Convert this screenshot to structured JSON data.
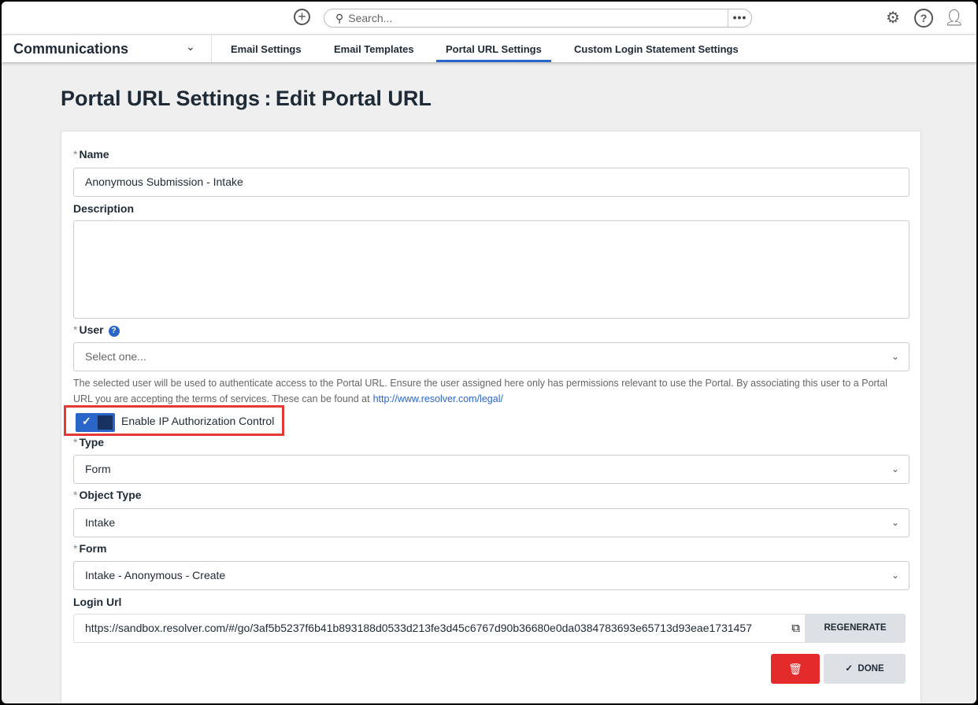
{
  "topbar": {
    "search_placeholder": "Search...",
    "more": "•••",
    "icons": [
      "add-icon",
      "search-icon",
      "settings-icon",
      "help-icon",
      "user-icon"
    ]
  },
  "nav": {
    "app": "Communications",
    "tabs": [
      {
        "label": "Email Settings"
      },
      {
        "label": "Email Templates"
      },
      {
        "label": "Portal URL Settings",
        "active": true
      },
      {
        "label": "Custom Login Statement Settings"
      }
    ]
  },
  "page": {
    "title": "Portal URL Settings : Edit Portal URL"
  },
  "form": {
    "required_mark": "*",
    "name_label": "Name",
    "name_value": "Anonymous Submission - Intake",
    "description_label": "Description",
    "description_value": "",
    "user_label": "User",
    "user_placeholder": "Select one...",
    "help_icon": "?",
    "user_help": "The selected user will be used to authenticate access to the Portal URL. Ensure the user assigned here only has permissions relevant to use the Portal. By associating this user to a Portal URL you are accepting the terms of services. These can be found at",
    "user_help_link": "http://www.resolver.com/legal/",
    "ip_toggle_label": "Enable IP Authorization Control",
    "ip_toggle_on": true,
    "type_label": "Type",
    "type_value": "Form",
    "object_type_label": "Object Type",
    "object_type_value": "Intake",
    "form_label": "Form",
    "form_value": "Intake - Anonymous - Create",
    "login_url_label": "Login Url",
    "login_url_value": "https://sandbox.resolver.com/#/go/3af5b5237f6b41b893188d0533d213fe3d45c6767d90b36680e0da0384783693e65713d93eae1731457",
    "regenerate": "REGENERATE",
    "done": "DONE"
  },
  "colors": {
    "accent": "#2a66c9",
    "danger": "#e32b2b",
    "highlight": "#e53935"
  }
}
